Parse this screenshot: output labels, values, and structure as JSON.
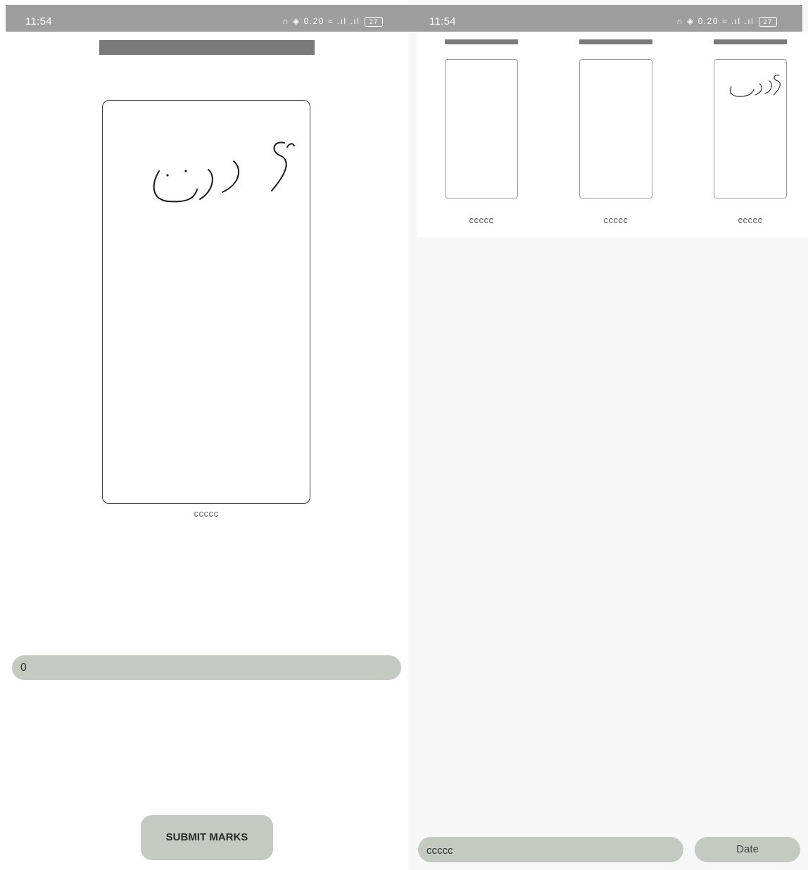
{
  "status_bar": {
    "time": "11:54",
    "icons": "headphones-icon, hotspot-icon, network-speed-icon, wifi-icon, signal-icon, signal-icon",
    "network_speed": "0.20",
    "battery_level": "27"
  },
  "left": {
    "card_label": "ccccc",
    "marks_value": "0",
    "submit_label": "SUBMIT MARKS"
  },
  "right": {
    "items": [
      {
        "label": "ccccc"
      },
      {
        "label": "ccccc"
      },
      {
        "label": "ccccc"
      }
    ],
    "search_value": "ccccc",
    "date_label": "Date"
  },
  "colors": {
    "status_bar": "#9e9e9e",
    "placeholder_bar": "#7a7a7a",
    "control_fill": "#c3cac0",
    "right_background": "#f7f7f7"
  }
}
